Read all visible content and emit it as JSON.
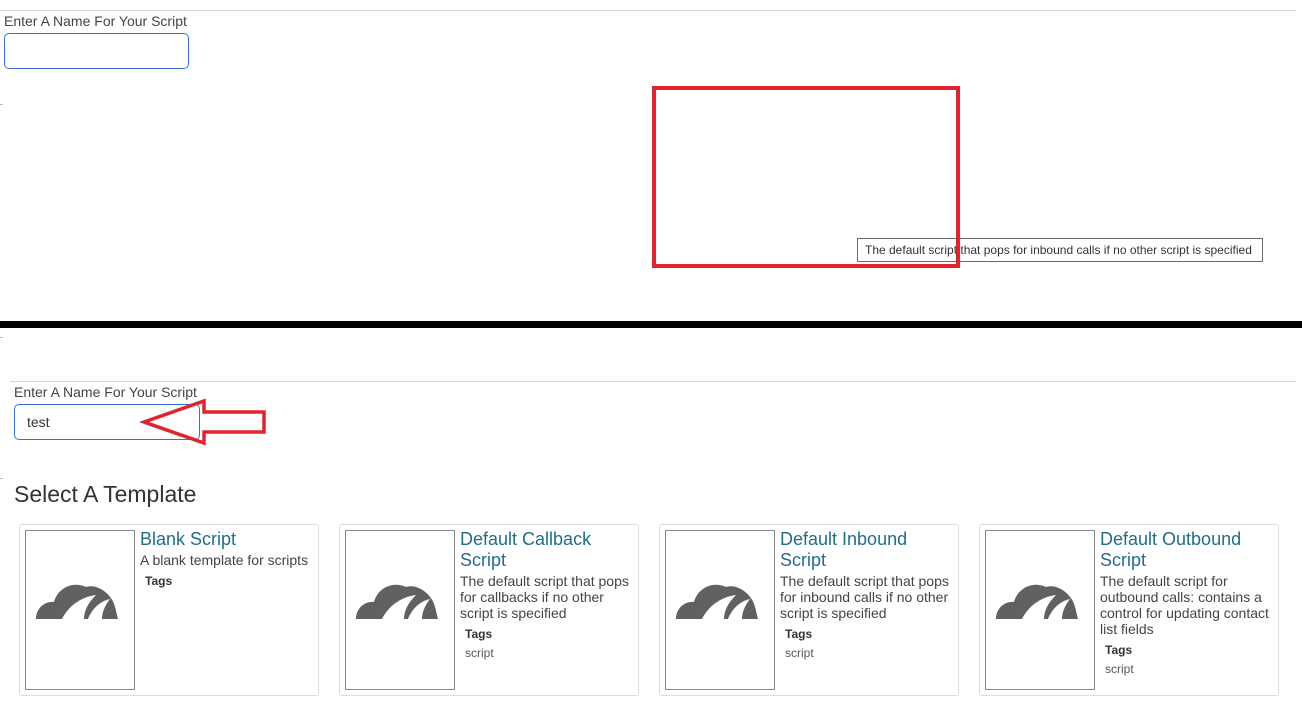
{
  "top_panel": {
    "name_label": "Enter A Name For Your Script",
    "name_value": "",
    "tooltip": "The default script that pops for inbound calls if no other script is specified"
  },
  "bottom_panel": {
    "name_label": "Enter A Name For Your Script",
    "name_value": "test",
    "section_title": "Select A Template",
    "templates": [
      {
        "title": "Blank Script",
        "description": "A blank template for scripts",
        "tags_label": "Tags",
        "tags": []
      },
      {
        "title": "Default Callback Script",
        "description": "The default script that pops for callbacks if no other script is specified",
        "tags_label": "Tags",
        "tags": [
          "script"
        ]
      },
      {
        "title": "Default Inbound Script",
        "description": "The default script that pops for inbound calls if no other script is specified",
        "tags_label": "Tags",
        "tags": [
          "script"
        ]
      },
      {
        "title": "Default Outbound Script",
        "description": "The default script for outbound calls: contains a control for updating contact list fields",
        "tags_label": "Tags",
        "tags": [
          "script"
        ]
      }
    ]
  },
  "annotations": {
    "highlight_color": "#e3232b",
    "link_color": "#1f6e8a",
    "input_border_color": "#3b6fd8"
  }
}
